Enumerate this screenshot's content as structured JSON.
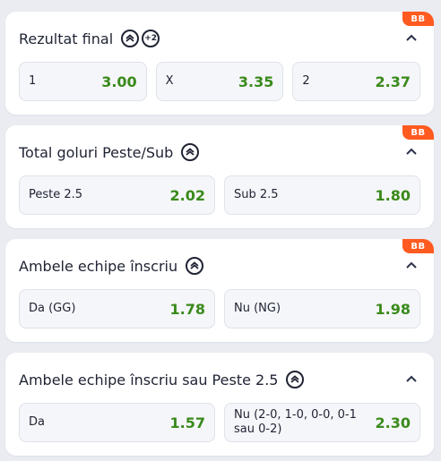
{
  "colors": {
    "odds": "#3a8a1c",
    "badge": "#ff5a1f",
    "card": "#ffffff",
    "background": "#eaecf2"
  },
  "markets": [
    {
      "title": "Rezultat final",
      "badge": "BB",
      "icons": [
        "bet-builder-icon",
        "plus-2-icon"
      ],
      "plus_icon_text": "+2",
      "selections": [
        {
          "label": "1",
          "odd": "3.00"
        },
        {
          "label": "X",
          "odd": "3.35"
        },
        {
          "label": "2",
          "odd": "2.37"
        }
      ]
    },
    {
      "title": "Total goluri Peste/Sub",
      "badge": "BB",
      "icons": [
        "bet-builder-icon"
      ],
      "selections": [
        {
          "label": "Peste 2.5",
          "odd": "2.02"
        },
        {
          "label": "Sub 2.5",
          "odd": "1.80"
        }
      ]
    },
    {
      "title": "Ambele echipe înscriu",
      "badge": "BB",
      "icons": [
        "bet-builder-icon"
      ],
      "selections": [
        {
          "label": "Da (GG)",
          "odd": "1.78"
        },
        {
          "label": "Nu (NG)",
          "odd": "1.98"
        }
      ]
    },
    {
      "title": "Ambele echipe înscriu sau Peste 2.5",
      "icons": [
        "bet-builder-icon"
      ],
      "selections": [
        {
          "label": "Da",
          "odd": "1.57"
        },
        {
          "label": "Nu (2-0, 1-0, 0-0, 0-1 sau 0-2)",
          "odd": "2.30"
        }
      ]
    }
  ]
}
